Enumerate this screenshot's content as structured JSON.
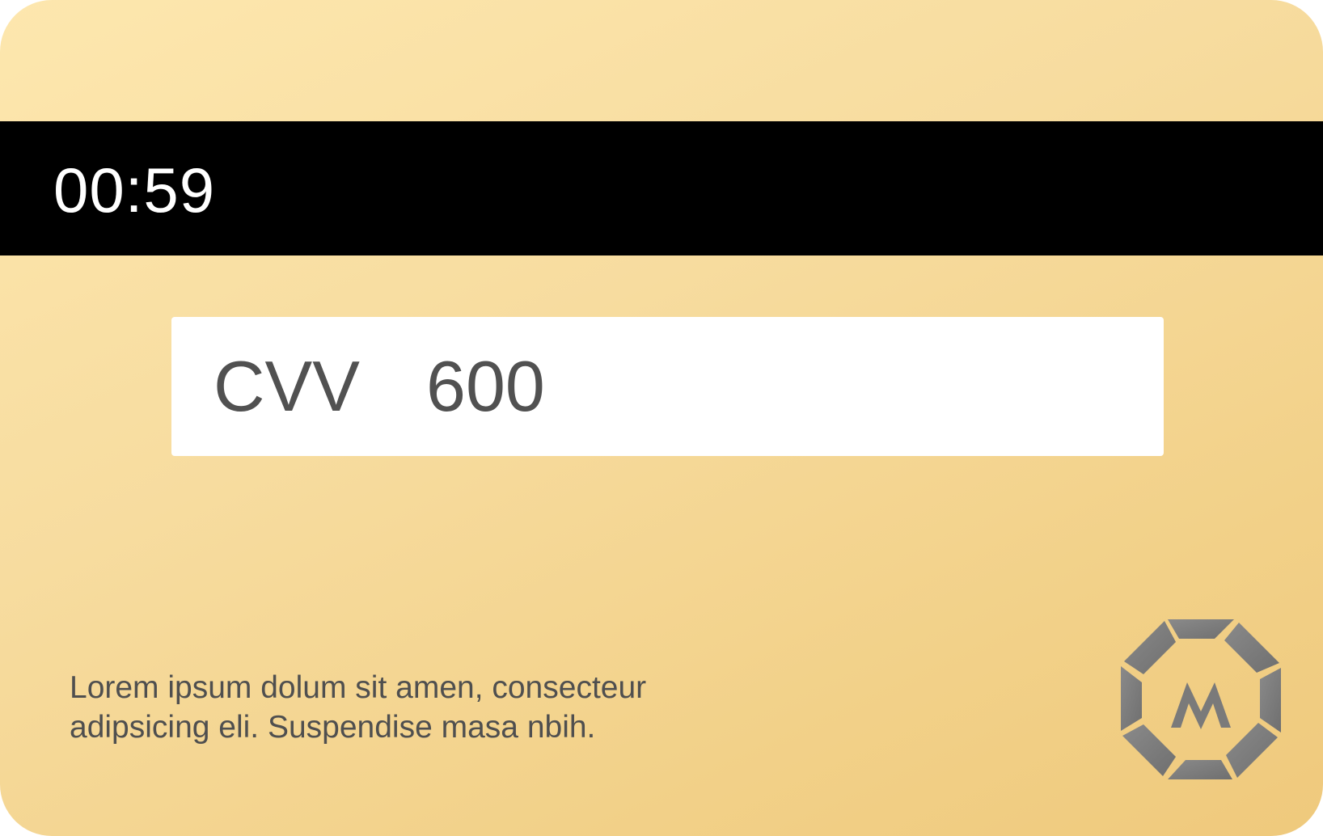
{
  "card": {
    "timer": "00:59",
    "cvv": {
      "label": "CVV",
      "value": "600"
    },
    "footer": {
      "line1": "Lorem ipsum dolum sit amen, consecteur",
      "line2": "adipsicing eli. Suspendise masa nbih."
    },
    "logo": {
      "icon": "octagon-m-logo",
      "letter": "M"
    },
    "colors": {
      "card_gradient_start": "#fde7ae",
      "card_gradient_end": "#efc97c",
      "stripe": "#000000",
      "logo": "#7d7d7d"
    }
  }
}
